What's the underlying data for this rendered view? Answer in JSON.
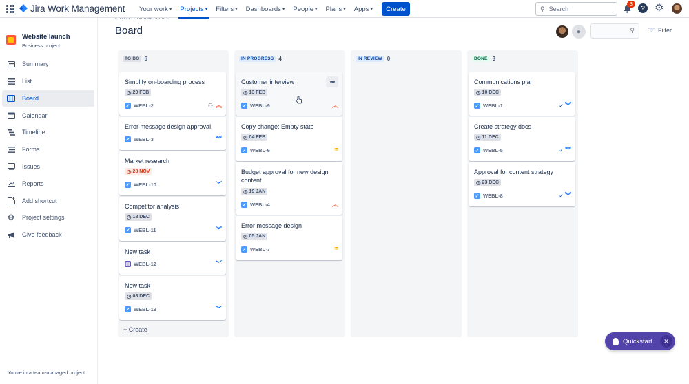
{
  "topbar": {
    "app_name": "Jira Work Management",
    "nav": [
      {
        "label": "Your work"
      },
      {
        "label": "Projects"
      },
      {
        "label": "Filters"
      },
      {
        "label": "Dashboards"
      },
      {
        "label": "People"
      },
      {
        "label": "Plans"
      },
      {
        "label": "Apps"
      }
    ],
    "create_label": "Create",
    "search_placeholder": "Search",
    "notification_count": "3"
  },
  "sidebar": {
    "project_name": "Website launch",
    "project_type": "Business project",
    "items": [
      {
        "label": "Summary",
        "icon": "summary-icon"
      },
      {
        "label": "List",
        "icon": "list-icon"
      },
      {
        "label": "Board",
        "icon": "board-icon"
      },
      {
        "label": "Calendar",
        "icon": "calendar-icon"
      },
      {
        "label": "Timeline",
        "icon": "timeline-icon"
      },
      {
        "label": "Forms",
        "icon": "forms-icon"
      },
      {
        "label": "Issues",
        "icon": "issues-icon"
      },
      {
        "label": "Reports",
        "icon": "reports-icon"
      },
      {
        "label": "Add shortcut",
        "icon": "add-shortcut-icon"
      },
      {
        "label": "Project settings",
        "icon": "gear-icon"
      },
      {
        "label": "Give feedback",
        "icon": "megaphone-icon"
      }
    ],
    "footer": "You're in a team-managed project"
  },
  "board": {
    "breadcrumb": "Projects  /  Website launch",
    "title": "Board",
    "filter_label": "Filter",
    "create_label": "+ Create",
    "columns": [
      {
        "title": "TO DO",
        "count": "6",
        "cards": [
          {
            "title": "Simplify on-boarding process",
            "date": "20 FEB",
            "key": "WEBL-2",
            "priority": "high"
          },
          {
            "title": "Error message design approval",
            "key": "WEBL-3",
            "priority": "lowest"
          },
          {
            "title": "Market research",
            "date": "28 NOV",
            "key": "WEBL-10",
            "priority": "low"
          },
          {
            "title": "Competitor analysis",
            "date": "18 DEC",
            "key": "WEBL-11",
            "priority": "lowest"
          },
          {
            "title": "New task",
            "key": "WEBL-12",
            "priority": "low"
          },
          {
            "title": "New task",
            "date": "08 DEC",
            "key": "WEBL-13",
            "priority": "low"
          }
        ]
      },
      {
        "title": "IN PROGRESS",
        "count": "4",
        "cards": [
          {
            "title": "Customer interview",
            "date": "13 FEB",
            "key": "WEBL-9",
            "priority": "high"
          },
          {
            "title": "Copy change: Empty state",
            "date": "04 FEB",
            "key": "WEBL-6",
            "priority": "medium"
          },
          {
            "title": "Budget approval for new design content",
            "date": "19 JAN",
            "key": "WEBL-4",
            "priority": "high"
          },
          {
            "title": "Error message design",
            "date": "05 JAN",
            "key": "WEBL-7",
            "priority": "medium"
          }
        ]
      },
      {
        "title": "IN REVIEW",
        "count": "0",
        "cards": []
      },
      {
        "title": "DONE",
        "count": "3",
        "cards": [
          {
            "title": "Communications plan",
            "date": "10 DEC",
            "key": "WEBL-1",
            "priority": "lowest"
          },
          {
            "title": "Create strategy docs",
            "date": "11 DEC",
            "key": "WEBL-5",
            "priority": "lowest"
          },
          {
            "title": "Approval for content strategy",
            "date": "23 DEC",
            "key": "WEBL-8",
            "priority": "lowest"
          }
        ]
      }
    ]
  },
  "quickstart": {
    "label": "Quickstart"
  },
  "colors": {
    "accent": "#0052cc",
    "quickstart": "#5243aa",
    "overdue": "#de350b"
  }
}
